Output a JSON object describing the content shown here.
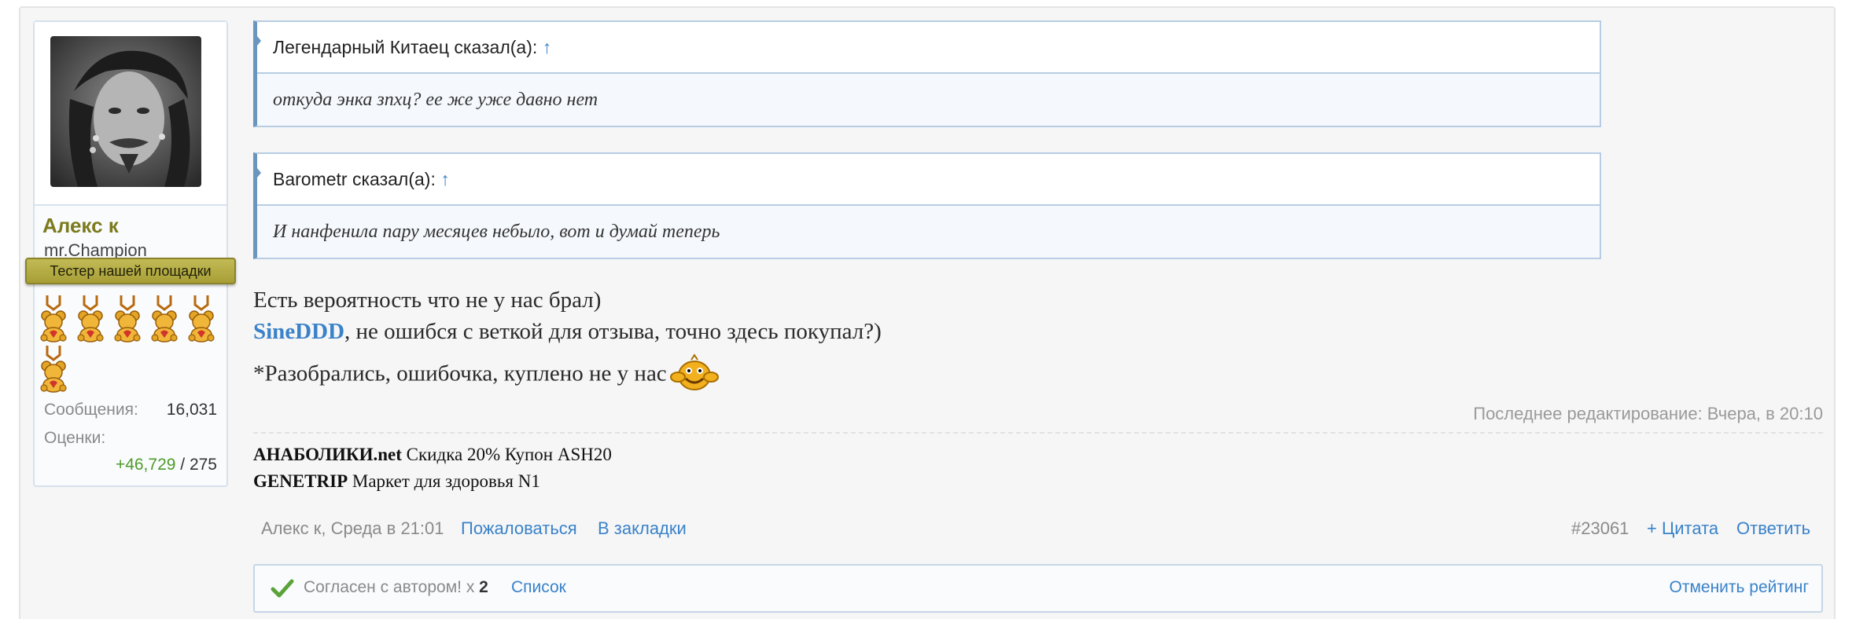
{
  "user": {
    "name": "Алекс к",
    "title": "mr.Champion",
    "banner": "Тестер нашей площадки",
    "trophy_count": 6,
    "stats": {
      "messages_label": "Сообщения:",
      "messages_value": "16,031",
      "ratings_label": "Оценки:",
      "ratings_positive": "+46,729",
      "ratings_sep": " / ",
      "ratings_total": "275"
    }
  },
  "quotes": [
    {
      "author_line": "Легендарный Китаец сказал(а):",
      "arrow": "↑",
      "text": "откуда энка зпхц? ее же уже давно нет"
    },
    {
      "author_line": "Barometr сказал(а):",
      "arrow": "↑",
      "text": "И нанфенила пару месяцев небыло, вот и думай теперь"
    }
  ],
  "message": {
    "line1": "Есть вероятность что не у нас брал)",
    "mention": "SineDDD",
    "line2_rest": ", не ошибся с веткой для отзыва, точно здесь покупал?)",
    "line3": "*Разобрались, ошибочка, куплено не у нас"
  },
  "edit_note": "Последнее редактирование: Вчера, в 20:10",
  "signature": [
    {
      "bold": "АНАБОЛИКИ.net",
      "rest": " Скидка 20% Купон ASH20"
    },
    {
      "bold": "GENETRIP",
      "rest": " Маркет для здоровья N1"
    }
  ],
  "footer": {
    "author_date": "Алекс к, Среда в 21:01",
    "report": "Пожаловаться",
    "bookmark": "В закладки",
    "post_number": "#23061",
    "quote": "+ Цитата",
    "reply": "Ответить"
  },
  "likes": {
    "text": "Согласен с автором! x ",
    "count": "2",
    "list": "Список",
    "cancel": "Отменить рейтинг"
  },
  "colors": {
    "username": "#7c7a1c",
    "link": "#3a82c9",
    "positive": "#4e9a2a",
    "quote_border": "#6a95bf"
  }
}
